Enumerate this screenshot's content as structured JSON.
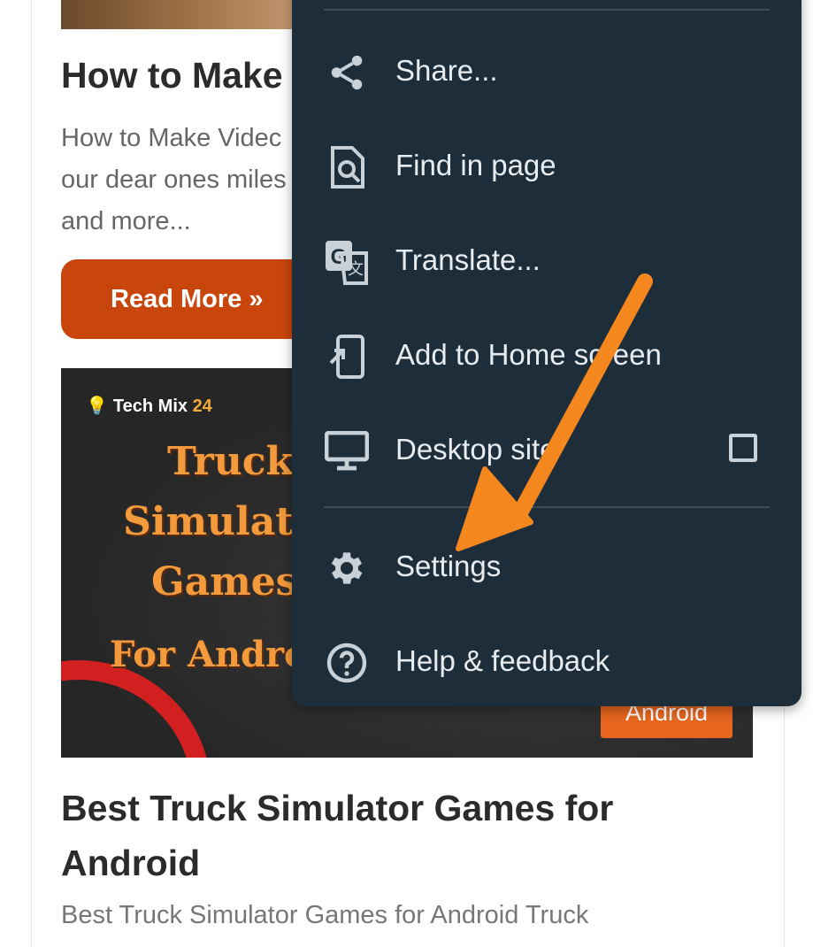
{
  "page": {
    "post1": {
      "title": "How to Make",
      "excerpt_lines": [
        "How to Make Videc",
        "our dear ones miles",
        "and more..."
      ],
      "read_more": "Read More »"
    },
    "thumbnail": {
      "logo_name": "Tech Mix",
      "logo_number": "24",
      "lines": [
        "Truck",
        "Simulato",
        "Games",
        "For Andro"
      ],
      "badge": "Android"
    },
    "post2": {
      "title": "Best Truck Simulator Games for Android",
      "excerpt": "Best Truck Simulator Games for Android Truck"
    }
  },
  "menu": {
    "items": [
      {
        "label": "Share...",
        "icon": "share-icon"
      },
      {
        "label": "Find in page",
        "icon": "find-in-page-icon"
      },
      {
        "label": "Translate...",
        "icon": "translate-icon"
      },
      {
        "label": "Add to Home screen",
        "icon": "add-to-home-icon"
      },
      {
        "label": "Desktop site",
        "icon": "desktop-icon",
        "checked": false
      },
      {
        "label": "Settings",
        "icon": "gear-icon"
      },
      {
        "label": "Help & feedback",
        "icon": "help-icon"
      }
    ]
  },
  "colors": {
    "menu_bg": "#1e2d3a",
    "menu_text": "#e7ecf0",
    "accent_button": "#c8460c",
    "annotation_arrow": "#f5871f"
  }
}
